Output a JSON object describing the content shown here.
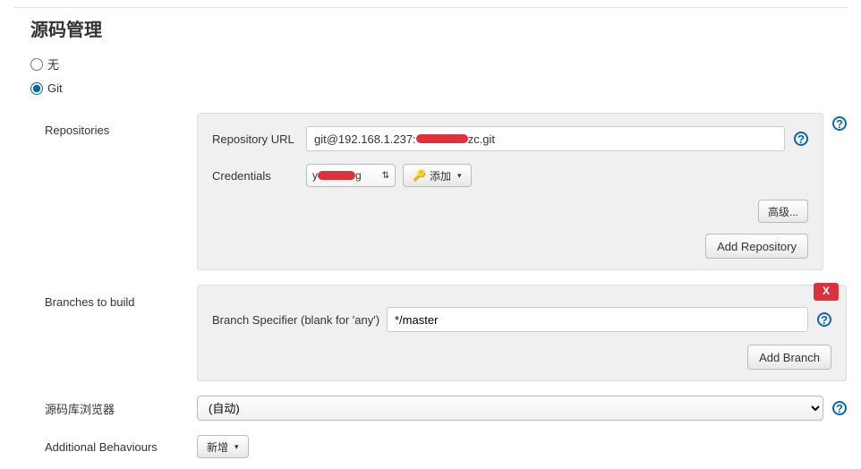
{
  "section_title": "源码管理",
  "scm_options": {
    "none": {
      "label": "无",
      "checked": false
    },
    "git": {
      "label": "Git",
      "checked": true
    }
  },
  "repositories": {
    "label": "Repositories",
    "repo_url_label": "Repository URL",
    "repo_url_value_prefix": "git@192.168.1.237:",
    "repo_url_value_suffix": "zc.git",
    "credentials_label": "Credentials",
    "credentials_value_prefix": "y",
    "credentials_value_suffix": "g",
    "add_credential_label": "添加",
    "advanced_label": "高级...",
    "add_repository_label": "Add Repository"
  },
  "branches": {
    "label": "Branches to build",
    "branch_specifier_label": "Branch Specifier (blank for 'any')",
    "branch_specifier_value": "*/master",
    "add_branch_label": "Add Branch",
    "delete_label": "X"
  },
  "repo_browser": {
    "label": "源码库浏览器",
    "value": "(自动)"
  },
  "additional": {
    "label": "Additional Behaviours",
    "add_label": "新增"
  },
  "help_symbol": "?"
}
